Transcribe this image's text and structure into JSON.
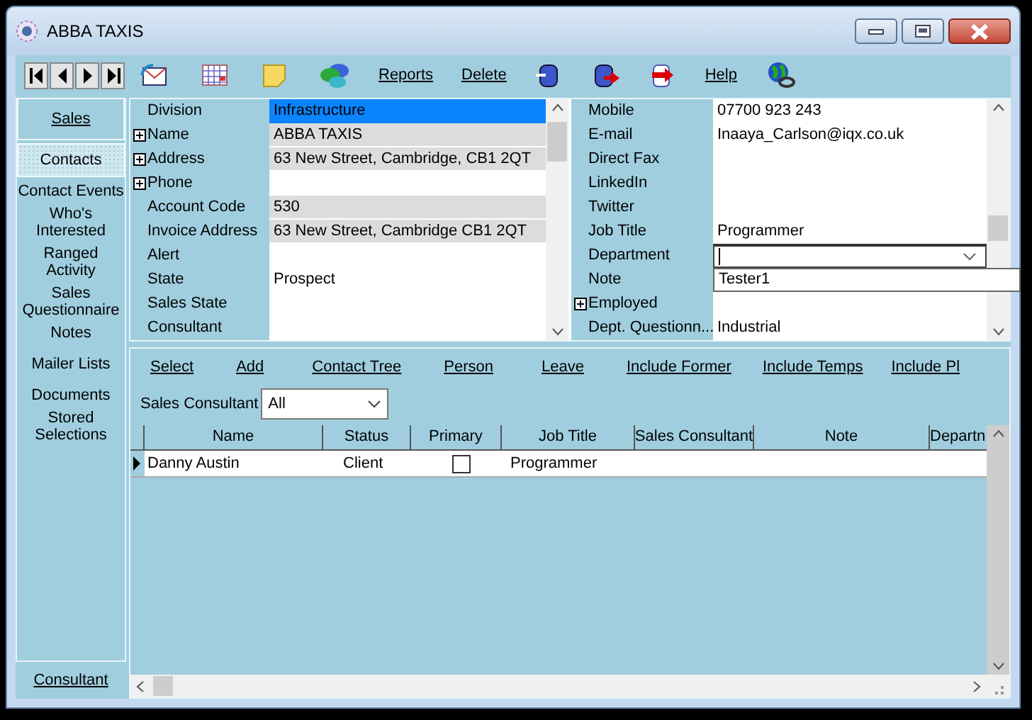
{
  "window": {
    "title": "ABBA TAXIS"
  },
  "toolbar": {
    "links_left": [
      "Reports",
      "Delete"
    ],
    "links_right": [
      "Help"
    ]
  },
  "sidebar": {
    "items": [
      {
        "label": "Sales",
        "kind": "tab",
        "selected": false
      },
      {
        "label": "Contacts",
        "kind": "tab",
        "selected": true
      },
      {
        "label": "Contact Events",
        "kind": "plain",
        "selected": false
      },
      {
        "label": "Who's Interested",
        "kind": "wrapped",
        "selected": false
      },
      {
        "label": "Ranged Activity",
        "kind": "wrapped",
        "selected": false
      },
      {
        "label": "Sales Questionnaire",
        "kind": "wrapped",
        "selected": false
      },
      {
        "label": "Notes",
        "kind": "plain",
        "selected": false
      },
      {
        "label": "Mailer Lists",
        "kind": "plain",
        "selected": false
      },
      {
        "label": "Documents",
        "kind": "plain",
        "selected": false
      },
      {
        "label": "Stored Selections",
        "kind": "wrapped",
        "selected": false
      }
    ],
    "footer": "Consultant"
  },
  "form_left": [
    {
      "label": "Division",
      "value": "Infrastructure",
      "expandable": false,
      "readonly": false,
      "selected": true
    },
    {
      "label": "Name",
      "value": "ABBA TAXIS",
      "expandable": true,
      "readonly": true,
      "selected": false
    },
    {
      "label": "Address",
      "value": "63 New Street, Cambridge, CB1 2QT",
      "expandable": true,
      "readonly": true,
      "selected": false
    },
    {
      "label": "Phone",
      "expandable": true,
      "readonly": false,
      "selected": false
    },
    {
      "label": "Account Code",
      "value": "530",
      "expandable": false,
      "readonly": true,
      "selected": false
    },
    {
      "label": "Invoice Address",
      "value": "63 New Street, Cambridge CB1 2QT",
      "expandable": false,
      "readonly": true,
      "selected": false
    },
    {
      "label": "Alert",
      "expandable": false,
      "readonly": false,
      "selected": false
    },
    {
      "label": "State",
      "value": "Prospect",
      "expandable": false,
      "readonly": false,
      "selected": false
    },
    {
      "label": "Sales State",
      "expandable": false,
      "readonly": false,
      "selected": false
    },
    {
      "label": "Consultant",
      "expandable": false,
      "readonly": false,
      "selected": false
    }
  ],
  "form_right": [
    {
      "label": "Mobile",
      "value": "07700 923 243",
      "kind": "text",
      "expandable": false
    },
    {
      "label": "E-mail",
      "value": "Inaaya_Carlson@iqx.co.uk",
      "kind": "text",
      "expandable": false
    },
    {
      "label": "Direct Fax",
      "kind": "text",
      "expandable": false
    },
    {
      "label": "LinkedIn",
      "kind": "text",
      "expandable": false
    },
    {
      "label": "Twitter",
      "kind": "text",
      "expandable": false
    },
    {
      "label": "Job Title",
      "value": "Programmer",
      "kind": "text",
      "expandable": false
    },
    {
      "label": "Department",
      "kind": "dropdown",
      "expandable": false
    },
    {
      "label": "Note",
      "value": "Tester1",
      "kind": "input",
      "expandable": false
    },
    {
      "label": "Employed",
      "kind": "text",
      "expandable": true
    },
    {
      "label": "Dept. Questionn...",
      "value": "Industrial",
      "kind": "text",
      "expandable": false
    }
  ],
  "contacts_panel": {
    "links": [
      "Select",
      "Add",
      "Contact Tree",
      "Person",
      "Leave",
      "Include Former",
      "Include Temps",
      "Include Pl"
    ],
    "filter": {
      "label": "Sales Consultant",
      "value": "All"
    },
    "columns": [
      "Name",
      "Status",
      "Primary",
      "Job Title",
      "Sales Consultant",
      "Note",
      "Departn"
    ],
    "rows": [
      {
        "name": "Danny Austin",
        "status": "Client",
        "primary": false,
        "job_title": "Programmer",
        "current": true
      }
    ]
  }
}
